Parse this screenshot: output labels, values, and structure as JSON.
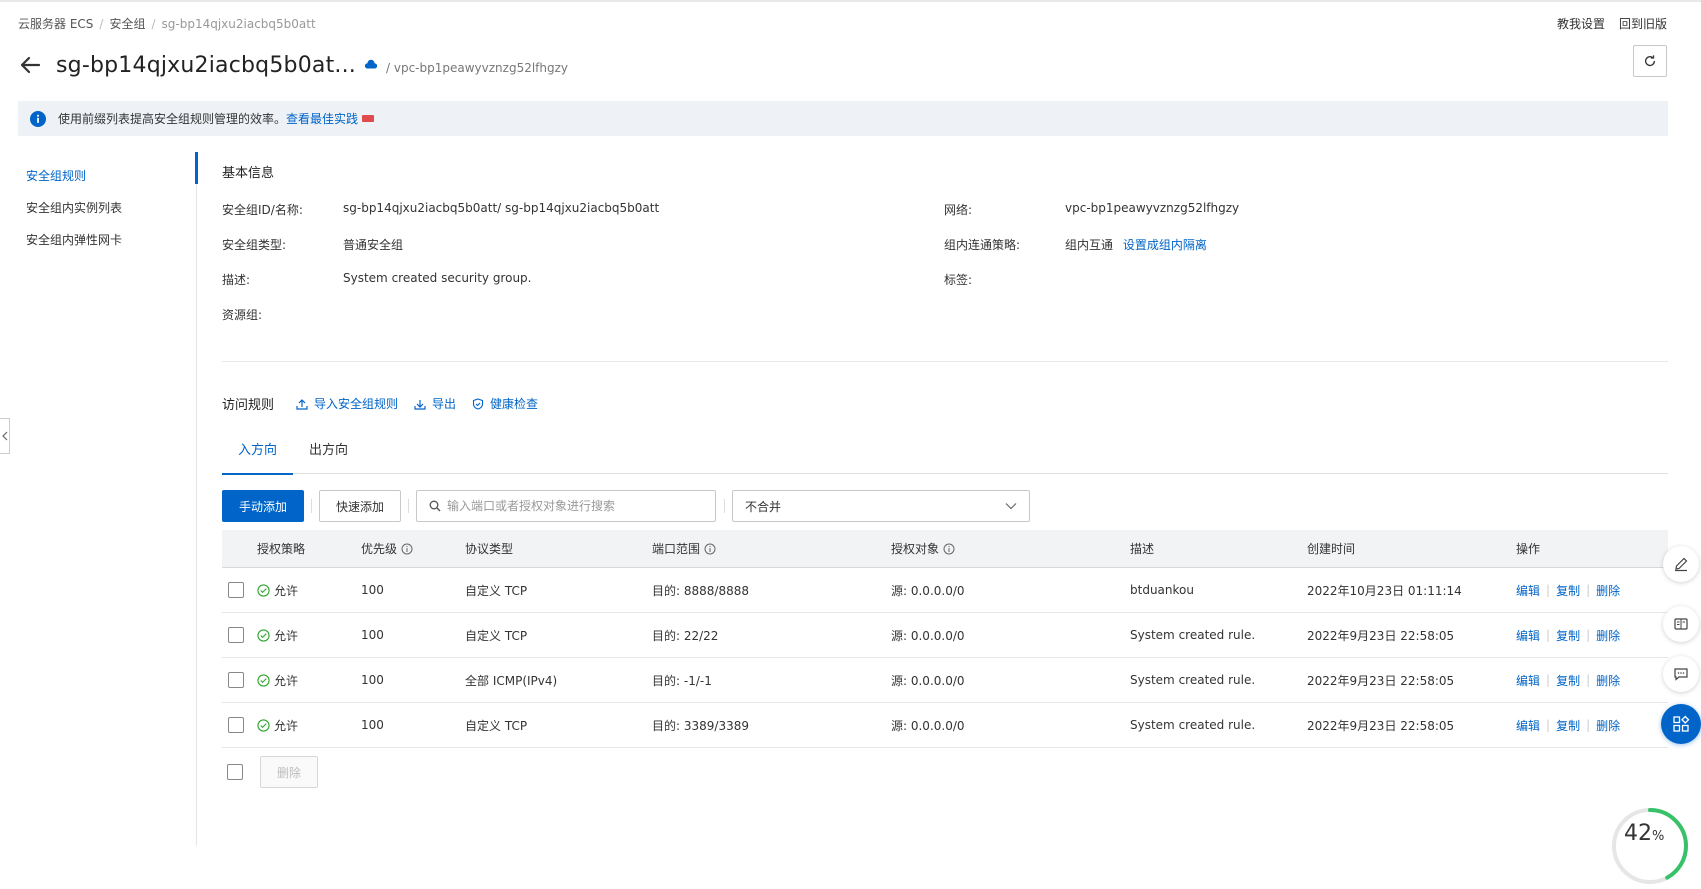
{
  "breadcrumb": {
    "items": [
      "云服务器 ECS",
      "安全组"
    ],
    "current": "sg-bp14qjxu2iacbq5b0att"
  },
  "top_right": {
    "teach_settings": "教我设置",
    "back_old": "回到旧版"
  },
  "header": {
    "title": "sg-bp14qjxu2iacbq5b0at...",
    "vpc": "/ vpc-bp1peawyvznzg52lfhgzy"
  },
  "notice": {
    "text": "使用前缀列表提高安全组规则管理的效率。",
    "link": "查看最佳实践"
  },
  "sidenav": {
    "items": [
      {
        "label": "安全组规则"
      },
      {
        "label": "安全组内实例列表"
      },
      {
        "label": "安全组内弹性网卡"
      }
    ]
  },
  "basic": {
    "title": "基本信息",
    "sg_id_label": "安全组ID/名称:",
    "sg_id_value": "sg-bp14qjxu2iacbq5b0att/ sg-bp14qjxu2iacbq5b0att",
    "network_label": "网络:",
    "network_value": "vpc-bp1peawyvznzg52lfhgzy",
    "type_label": "安全组类型:",
    "type_value": "普通安全组",
    "policy_label": "组内连通策略:",
    "policy_value": "组内互通",
    "policy_link": "设置成组内隔离",
    "desc_label": "描述:",
    "desc_value": "System created security group.",
    "tag_label": "标签:",
    "rg_label": "资源组:"
  },
  "rules": {
    "title": "访问规则",
    "import": "导入安全组规则",
    "export": "导出",
    "health": "健康检查",
    "tabs": [
      "入方向",
      "出方向"
    ],
    "manual_add": "手动添加",
    "quick_add": "快速添加",
    "search_placeholder": "输入端口或者授权对象进行搜索",
    "merge_select": "不合并",
    "columns": {
      "policy": "授权策略",
      "priority": "优先级",
      "protocol": "协议类型",
      "port": "端口范围",
      "target": "授权对象",
      "desc": "描述",
      "created": "创建时间",
      "ops": "操作"
    },
    "rows": [
      {
        "policy": "允许",
        "priority": "100",
        "protocol": "自定义 TCP",
        "port": "目的: 8888/8888",
        "target": "源: 0.0.0.0/0",
        "desc": "btduankou",
        "created": "2022年10月23日 01:11:14"
      },
      {
        "policy": "允许",
        "priority": "100",
        "protocol": "自定义 TCP",
        "port": "目的: 22/22",
        "target": "源: 0.0.0.0/0",
        "desc": "System created rule.",
        "created": "2022年9月23日 22:58:05"
      },
      {
        "policy": "允许",
        "priority": "100",
        "protocol": "全部 ICMP(IPv4)",
        "port": "目的: -1/-1",
        "target": "源: 0.0.0.0/0",
        "desc": "System created rule.",
        "created": "2022年9月23日 22:58:05"
      },
      {
        "policy": "允许",
        "priority": "100",
        "protocol": "自定义 TCP",
        "port": "目的: 3389/3389",
        "target": "源: 0.0.0.0/0",
        "desc": "System created rule.",
        "created": "2022年9月23日 22:58:05"
      }
    ],
    "op_edit": "编辑",
    "op_copy": "复制",
    "op_delete": "删除",
    "bulk_delete": "删除"
  },
  "progress": {
    "value": 42,
    "unit": "%"
  },
  "colors": {
    "brand": "#0064c8",
    "success": "#2fa52f",
    "notice_bg": "#eef2f7"
  }
}
